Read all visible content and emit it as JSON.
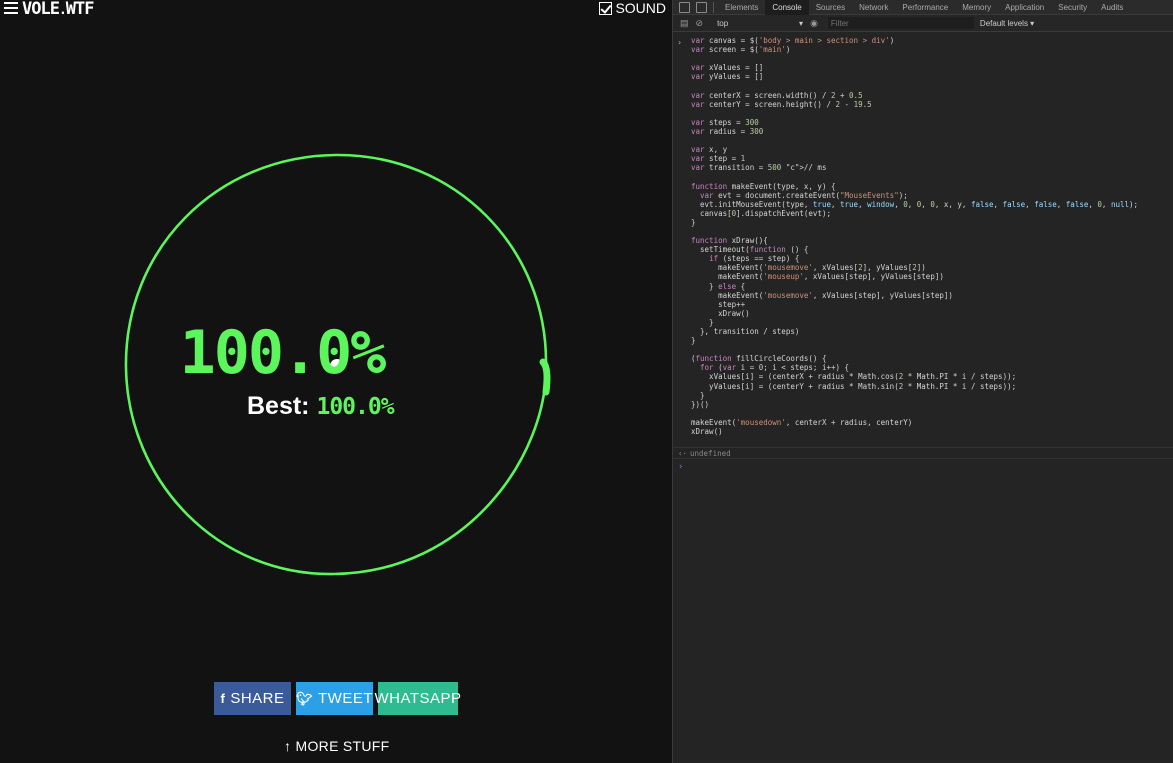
{
  "header": {
    "logo": "VOLE",
    "logo_suffix": "WTF",
    "sound_label": "SOUND",
    "sound_checked": true
  },
  "game": {
    "score": "100.0%",
    "best_label": "Best:",
    "best_value": "100.0%",
    "progress_fraction": 1.0,
    "accent_color": "#5cf55c"
  },
  "share": {
    "facebook_label": "SHARE",
    "twitter_label": "TWEET",
    "whatsapp_label": "WHATSAPP",
    "more_label": "MORE STUFF",
    "facebook_color": "#3b5a9a",
    "twitter_color": "#2ba0e6",
    "whatsapp_color": "#2dbb8f"
  },
  "devtools": {
    "tabs": [
      "Elements",
      "Console",
      "Sources",
      "Network",
      "Performance",
      "Memory",
      "Application",
      "Security",
      "Audits"
    ],
    "active_tab": "Console",
    "context": "top",
    "filter_placeholder": "Filter",
    "levels": "Default levels ▾",
    "result": "undefined",
    "code": [
      "var canvas = $('body > main > section > div')",
      "var screen = $('main')",
      "",
      "var xValues = []",
      "var yValues = []",
      "",
      "var centerX = screen.width() / 2 + 0.5",
      "var centerY = screen.height() / 2 - 19.5",
      "",
      "var steps = 300",
      "var radius = 300",
      "",
      "var x, y",
      "var step = 1",
      "var transition = 500 // ms",
      "",
      "function makeEvent(type, x, y) {",
      "  var evt = document.createEvent(\"MouseEvents\");",
      "  evt.initMouseEvent(type, true, true, window, 0, 0, 0, x, y, false, false, false, false, 0, null);",
      "  canvas[0].dispatchEvent(evt);",
      "}",
      "",
      "function xDraw(){",
      "  setTimeout(function () {",
      "    if (steps == step) {",
      "      makeEvent('mousemove', xValues[2], yValues[2])",
      "      makeEvent('mouseup', xValues[step], yValues[step])",
      "    } else {",
      "      makeEvent('mousemove', xValues[step], yValues[step])",
      "      step++",
      "      xDraw()",
      "    }",
      "  }, transition / steps)",
      "}",
      "",
      "(function fillCircleCoords() {",
      "  for (var i = 0; i < steps; i++) {",
      "    xValues[i] = (centerX + radius * Math.cos(2 * Math.PI * i / steps));",
      "    yValues[i] = (centerY + radius * Math.sin(2 * Math.PI * i / steps));",
      "  }",
      "})()",
      "",
      "makeEvent('mousedown', centerX + radius, centerY)",
      "xDraw()"
    ]
  }
}
